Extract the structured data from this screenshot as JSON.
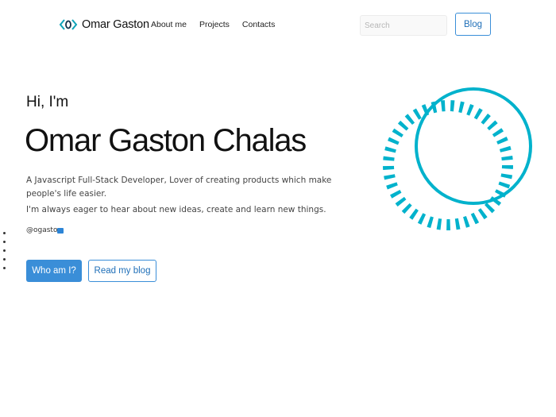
{
  "nav": {
    "brand_icon": "code-brackets-icon",
    "brand_name": "Omar Gaston",
    "links": [
      "About me",
      "Projects",
      "Contacts"
    ],
    "search_placeholder": "Search",
    "blog_label": "Blog"
  },
  "hero": {
    "greeting": "Hi, I'm",
    "name": "Omar Gaston Chalas",
    "description": "A Javascript Full-Stack Developer, Lover of creating products which make people's life easier.",
    "description2": "I'm always eager to hear about new ideas, create and learn new things.",
    "handle": "@ogaston",
    "primary_button": "Who am I?",
    "secondary_button": "Read my blog"
  },
  "colors": {
    "accent": "#3a8ed8",
    "ring": "#00b2cc",
    "brand_icon": "#0fa3b8"
  }
}
